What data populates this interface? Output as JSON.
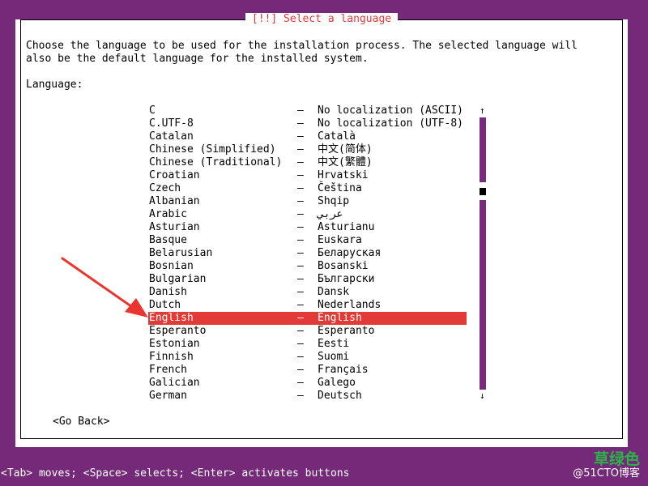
{
  "dialog": {
    "title": "[!!] Select a language",
    "intro": "Choose the language to be used for the installation process. The selected language will\nalso be the default language for the installed system.",
    "language_label": "Language:",
    "go_back": "<Go Back>"
  },
  "languages": [
    {
      "name": "C",
      "local": "No localization (ASCII)"
    },
    {
      "name": "C.UTF-8",
      "local": "No localization (UTF-8)"
    },
    {
      "name": "Catalan",
      "local": "Català"
    },
    {
      "name": "Chinese (Simplified)",
      "local": "中文(简体)"
    },
    {
      "name": "Chinese (Traditional)",
      "local": "中文(繁體)"
    },
    {
      "name": "Croatian",
      "local": "Hrvatski"
    },
    {
      "name": "Czech",
      "local": "Čeština"
    },
    {
      "name": "Albanian",
      "local": "Shqip"
    },
    {
      "name": "Arabic",
      "local": "عربي"
    },
    {
      "name": "Asturian",
      "local": "Asturianu"
    },
    {
      "name": "Basque",
      "local": "Euskara"
    },
    {
      "name": "Belarusian",
      "local": "Беларуская"
    },
    {
      "name": "Bosnian",
      "local": "Bosanski"
    },
    {
      "name": "Bulgarian",
      "local": "Български"
    },
    {
      "name": "Danish",
      "local": "Dansk"
    },
    {
      "name": "Dutch",
      "local": "Nederlands"
    },
    {
      "name": "English",
      "local": "English",
      "selected": true
    },
    {
      "name": "Esperanto",
      "local": "Esperanto"
    },
    {
      "name": "Estonian",
      "local": "Eesti"
    },
    {
      "name": "Finnish",
      "local": "Suomi"
    },
    {
      "name": "French",
      "local": "Français"
    },
    {
      "name": "Galician",
      "local": "Galego"
    },
    {
      "name": "German",
      "local": "Deutsch"
    }
  ],
  "separator": "–",
  "scrollbar": {
    "up_symbol": "↑",
    "down_symbol": "↓"
  },
  "statusbar": "<Tab> moves; <Space> selects; <Enter> activates buttons",
  "watermark": {
    "big": "草绿色",
    "small": "@51CTO博客"
  },
  "colors": {
    "background": "#742a78",
    "accent": "#e23a36",
    "arrow": "#e8352f",
    "watermark_green": "#2bb34a"
  }
}
